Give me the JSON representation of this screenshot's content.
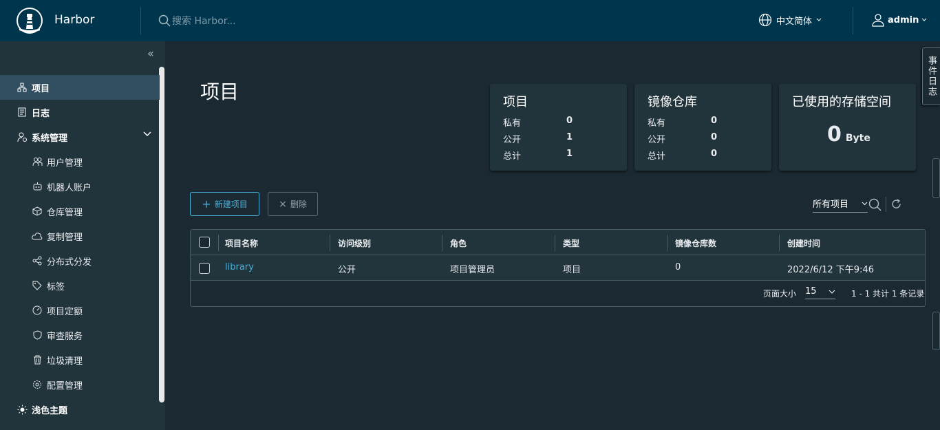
{
  "header": {
    "brand": "Harbor",
    "search_placeholder": "搜索 Harbor...",
    "language": "中文简体",
    "user": "admin"
  },
  "sidebar": {
    "items": [
      {
        "label": "项目",
        "icon": "projects-icon"
      },
      {
        "label": "日志",
        "icon": "logs-icon"
      },
      {
        "label": "系统管理",
        "icon": "system-admin-icon"
      },
      {
        "label": "用户管理",
        "icon": "users-icon"
      },
      {
        "label": "机器人账户",
        "icon": "robot-icon"
      },
      {
        "label": "仓库管理",
        "icon": "registry-icon"
      },
      {
        "label": "复制管理",
        "icon": "replication-icon"
      },
      {
        "label": "分布式分发",
        "icon": "distribution-icon"
      },
      {
        "label": "标签",
        "icon": "tag-icon"
      },
      {
        "label": "项目定额",
        "icon": "quota-icon"
      },
      {
        "label": "审查服务",
        "icon": "shield-icon"
      },
      {
        "label": "垃圾清理",
        "icon": "trash-icon"
      },
      {
        "label": "配置管理",
        "icon": "gear-icon"
      },
      {
        "label": "浅色主题",
        "icon": "sun-icon"
      }
    ]
  },
  "event_log_tab": "事件日志",
  "page": {
    "title": "项目"
  },
  "cards": {
    "projects": {
      "title": "项目",
      "rows": [
        {
          "label": "私有",
          "value": "0"
        },
        {
          "label": "公开",
          "value": "1"
        },
        {
          "label": "总计",
          "value": "1"
        }
      ]
    },
    "repos": {
      "title": "镜像仓库",
      "rows": [
        {
          "label": "私有",
          "value": "0"
        },
        {
          "label": "公开",
          "value": "0"
        },
        {
          "label": "总计",
          "value": "0"
        }
      ]
    },
    "storage": {
      "title": "已使用的存储空间",
      "value": "0",
      "unit": "Byte"
    }
  },
  "toolbar": {
    "new_project": "新建项目",
    "delete": "删除",
    "filter": "所有项目"
  },
  "table": {
    "columns": [
      "项目名称",
      "访问级别",
      "角色",
      "类型",
      "镜像仓库数",
      "创建时间"
    ],
    "rows": [
      {
        "name": "library",
        "access": "公开",
        "role": "项目管理员",
        "type": "项目",
        "repo_count": "0",
        "created": "2022/6/12 下午9:46"
      }
    ],
    "page_size_label": "页面大小",
    "page_size": "15",
    "summary": "1 - 1 共计 1 条记录"
  },
  "colors": {
    "header": "#00364d",
    "sidebar": "#21333b",
    "content": "#1b2a32",
    "accent": "#49afd9",
    "active_nav": "#324f61"
  }
}
